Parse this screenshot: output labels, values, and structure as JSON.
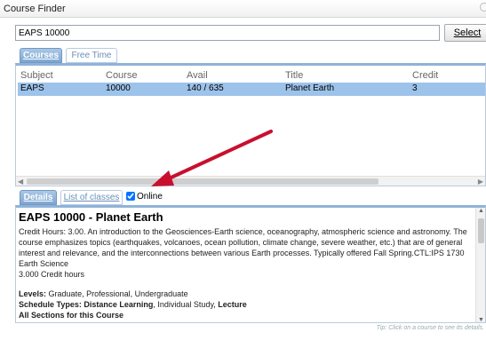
{
  "window": {
    "title": "Course Finder"
  },
  "search": {
    "value": "EAPS 10000",
    "button_label": "Select"
  },
  "top_tabs": [
    {
      "label": "Courses",
      "active": true
    },
    {
      "label": "Free Time",
      "active": false
    }
  ],
  "grid": {
    "headers": {
      "subject": "Subject",
      "course": "Course",
      "avail": "Avail",
      "title": "Title",
      "credit": "Credit"
    },
    "rows": [
      {
        "subject": "EAPS",
        "course": "10000",
        "avail": "140 / 635",
        "title": "Planet Earth",
        "credit": "3"
      }
    ]
  },
  "bottom_tabs": [
    {
      "label": "Details",
      "active": true
    },
    {
      "label": "List of classes",
      "active": false
    }
  ],
  "online": {
    "label": "Online",
    "checked": true
  },
  "details": {
    "heading": "EAPS 10000 - Planet Earth",
    "description": "Credit Hours: 3.00. An introduction to the Geosciences-Earth science, oceanography, atmospheric science and astronomy. The course emphasizes topics (earthquakes, volcanoes, ocean pollution, climate change, severe weather, etc.) that are of general interest and relevance, and the interconnections between various Earth processes. Typically offered Fall Spring.CTL:IPS 1730 Earth Science",
    "credit_hours": "3.000 Credit hours",
    "levels_label": "Levels:",
    "levels_value": "Graduate, Professional, Undergraduate",
    "schedule_label": "Schedule Types:",
    "schedule_dl": "Distance Learning",
    "schedule_mid": ", Individual Study, ",
    "schedule_lecture": "Lecture",
    "all_sections": "All Sections for this Course"
  },
  "tip": "Tip: Click on a course to see its details.",
  "colors": {
    "accent": "#8eb3d9",
    "selected_row": "#9dc3ea",
    "arrow": "#c8102e"
  }
}
